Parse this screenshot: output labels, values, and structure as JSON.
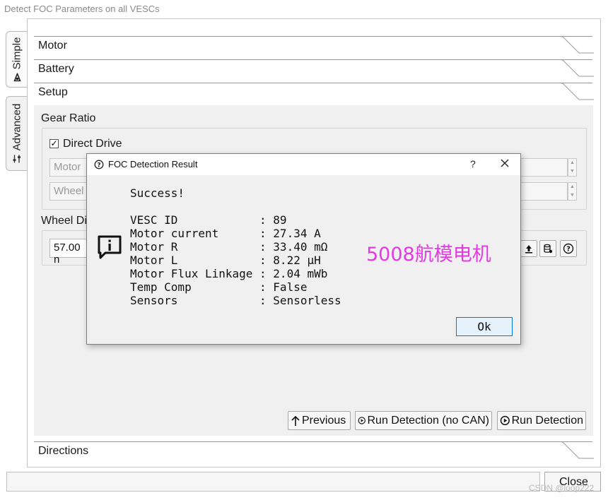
{
  "window": {
    "title": "Detect FOC Parameters on all VESCs"
  },
  "tabs": {
    "simple": {
      "label": "Simple",
      "icon": "motor-icon"
    },
    "advanced": {
      "label": "Advanced",
      "icon": "sliders-icon"
    }
  },
  "accordion": {
    "motor": "Motor",
    "battery": "Battery",
    "setup": "Setup",
    "directions": "Directions"
  },
  "setup": {
    "gear_ratio_label": "Gear Ratio",
    "direct_drive_label": "Direct Drive",
    "direct_drive_checked": "✓",
    "motor_field": "Motor",
    "wheel_field": "Wheel",
    "wheel_diameter_label": "Wheel Dia",
    "wheel_diameter_value": "57.00 n"
  },
  "nav": {
    "previous": "Previous",
    "run_no_can": "Run Detection (no CAN)",
    "run": "Run Detection"
  },
  "footer": {
    "close": "Close",
    "watermark": "CSDN @loop222"
  },
  "dialog": {
    "title": "FOC Detection Result",
    "help": "?",
    "status": "Success!",
    "rows": [
      {
        "label": "VESC ID",
        "value": "89"
      },
      {
        "label": "Motor current",
        "value": "27.34 A"
      },
      {
        "label": "Motor R",
        "value": "33.40 mΩ"
      },
      {
        "label": "Motor L",
        "value": "8.22 µH"
      },
      {
        "label": "Motor Flux Linkage",
        "value": "2.04 mWb"
      },
      {
        "label": "Temp Comp",
        "value": "False"
      },
      {
        "label": "Sensors",
        "value": "Sensorless"
      }
    ],
    "annotation": "5008航模电机",
    "ok": "Ok"
  },
  "colors": {
    "annotation": "#e23ce0",
    "ok_border": "#0078d7",
    "ok_bg": "#e5f1fb",
    "panel_bg": "#f0f0f0"
  }
}
